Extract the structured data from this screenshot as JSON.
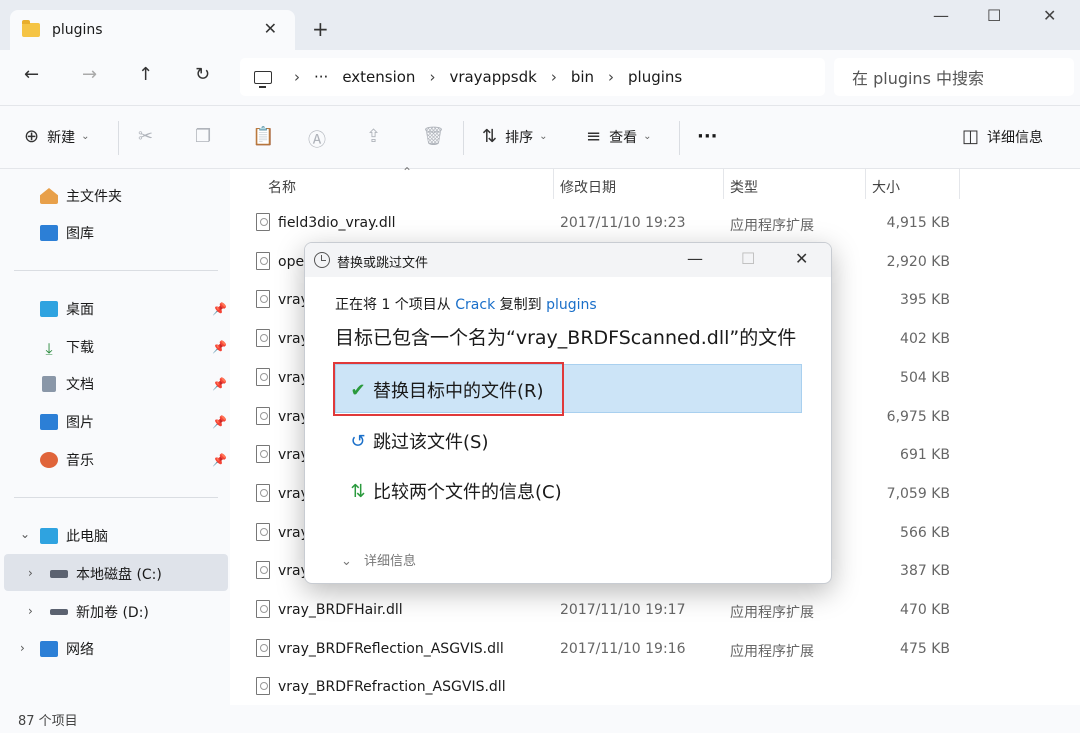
{
  "window": {
    "tab_label": "plugins",
    "tab_close": "✕",
    "new_tab": "+",
    "minimize": "—",
    "maximize": "☐",
    "close": "✕"
  },
  "address": {
    "back": "←",
    "forward": "→",
    "up": "↑",
    "refresh": "↻",
    "ellipsis": "···",
    "sep": "›",
    "path": [
      "extension",
      "vrayappsdk",
      "bin",
      "plugins"
    ],
    "search_placeholder": "在 plugins 中搜索"
  },
  "toolbar": {
    "new_label": "新建",
    "sort_label": "排序",
    "view_label": "查看",
    "more_label": "···",
    "details_label": "详细信息",
    "caret": "⌄"
  },
  "sidebar": {
    "home": "主文件夹",
    "gallery": "图库",
    "desktop": "桌面",
    "downloads": "下载",
    "documents": "文档",
    "pictures": "图片",
    "music": "音乐",
    "this_pc": "此电脑",
    "drive_c": "本地磁盘 (C:)",
    "drive_d": "新加卷 (D:)",
    "network": "网络",
    "pin": "📌",
    "expand": "›",
    "collapse": "⌄"
  },
  "columns": {
    "name": "名称",
    "date": "修改日期",
    "type": "类型",
    "size": "大小",
    "sort_caret": "⌃"
  },
  "files": [
    {
      "name": "field3dio_vray.dll",
      "date": "2017/11/10 19:23",
      "type": "应用程序扩展",
      "size": "4,915 KB"
    },
    {
      "name": "ope",
      "date": "",
      "type": "",
      "size": "2,920 KB"
    },
    {
      "name": "vray",
      "date": "",
      "type": "",
      "size": "395 KB"
    },
    {
      "name": "vray",
      "date": "",
      "type": "",
      "size": "402 KB"
    },
    {
      "name": "vray",
      "date": "",
      "type": "",
      "size": "504 KB"
    },
    {
      "name": "vray",
      "date": "",
      "type": "",
      "size": "6,975 KB"
    },
    {
      "name": "vray",
      "date": "",
      "type": "",
      "size": "691 KB"
    },
    {
      "name": "vray",
      "date": "",
      "type": "",
      "size": "7,059 KB"
    },
    {
      "name": "vray",
      "date": "",
      "type": "",
      "size": "566 KB"
    },
    {
      "name": "vray",
      "date": "",
      "type": "",
      "size": "387 KB"
    },
    {
      "name": "vray_BRDFHair.dll",
      "date": "2017/11/10 19:17",
      "type": "应用程序扩展",
      "size": "470 KB"
    },
    {
      "name": "vray_BRDFReflection_ASGVIS.dll",
      "date": "2017/11/10 19:16",
      "type": "应用程序扩展",
      "size": "475 KB"
    },
    {
      "name": "vray_BRDFRefraction_ASGVIS.dll",
      "date": "",
      "type": "",
      "size": ""
    }
  ],
  "status": {
    "count": "87 个项目"
  },
  "dialog": {
    "title": "替换或跳过文件",
    "line1_prefix": "正在将 1 个项目从 ",
    "line1_source": "Crack",
    "line1_mid": " 复制到 ",
    "line1_dest": "plugins",
    "line2": "目标已包含一个名为“vray_BRDFScanned.dll”的文件",
    "opt_replace": "替换目标中的文件(R)",
    "opt_skip": "跳过该文件(S)",
    "opt_compare": "比较两个文件的信息(C)",
    "more_details": "详细信息",
    "icon_check": "✔",
    "icon_skip": "↺",
    "icon_compare": "⇅",
    "icon_more": "⌄",
    "minimize": "—",
    "maximize": "☐",
    "close": "✕",
    "accent_color": "#1a6fc9",
    "highlight_color": "#cce4f7",
    "box_color": "#e0393a"
  }
}
